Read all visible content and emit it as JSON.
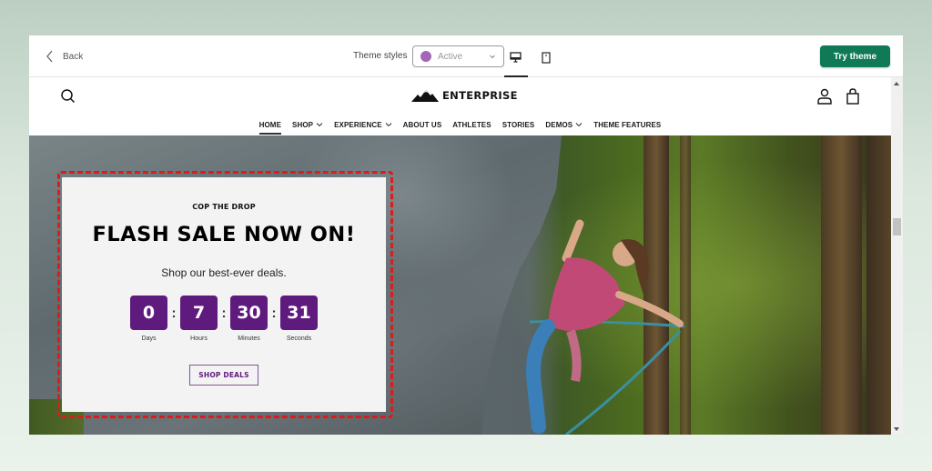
{
  "editor_bar": {
    "back_label": "Back",
    "theme_styles_label": "Theme styles",
    "theme_style_value": "Active",
    "theme_style_swatch_color": "#a566b8",
    "device_options": [
      "desktop",
      "mobile"
    ],
    "selected_device": "desktop",
    "try_theme_label": "Try theme",
    "accent_color": "#0f7a55"
  },
  "store": {
    "logo_text": "ENTERPRISE",
    "header_icons": [
      "search-icon",
      "account-icon",
      "cart-icon"
    ],
    "nav": [
      {
        "label": "HOME",
        "dropdown": false,
        "active": true
      },
      {
        "label": "SHOP",
        "dropdown": true,
        "active": false
      },
      {
        "label": "EXPERIENCE",
        "dropdown": true,
        "active": false
      },
      {
        "label": "ABOUT US",
        "dropdown": false,
        "active": false
      },
      {
        "label": "ATHLETES",
        "dropdown": false,
        "active": false
      },
      {
        "label": "STORIES",
        "dropdown": false,
        "active": false
      },
      {
        "label": "DEMOS",
        "dropdown": true,
        "active": false
      },
      {
        "label": "THEME FEATURES",
        "dropdown": false,
        "active": false
      }
    ],
    "hero": {
      "image_description": "Woman in pink t-shirt rock climbing on a boulder in a forest",
      "promo": {
        "eyebrow": "COP THE DROP",
        "title": "FLASH SALE NOW ON!",
        "subtitle": "Shop our best-ever deals.",
        "countdown": [
          {
            "value": "0",
            "label": "Days"
          },
          {
            "value": "7",
            "label": "Hours"
          },
          {
            "value": "30",
            "label": "Minutes"
          },
          {
            "value": "31",
            "label": "Seconds"
          }
        ],
        "separator": ":",
        "cta_label": "SHOP DEALS",
        "accent_color": "#5e1a7c",
        "highlight_outline_color": "#e01a1a"
      }
    }
  }
}
